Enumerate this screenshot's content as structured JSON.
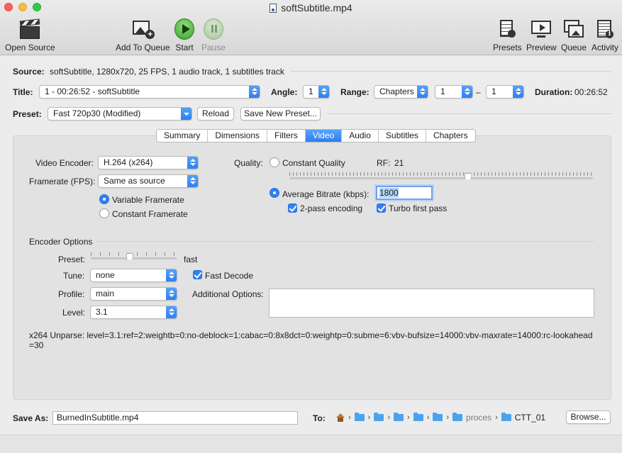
{
  "window": {
    "title": "softSubtitle.mp4"
  },
  "toolbar": {
    "open_source": "Open Source",
    "add_to_queue": "Add To Queue",
    "start": "Start",
    "pause": "Pause",
    "presets": "Presets",
    "preview": "Preview",
    "queue": "Queue",
    "activity": "Activity"
  },
  "source": {
    "label": "Source:",
    "value": "softSubtitle, 1280x720, 25 FPS, 1 audio track, 1 subtitles track"
  },
  "title_row": {
    "title_label": "Title:",
    "title_value": "1 - 00:26:52 - softSubtitle",
    "angle_label": "Angle:",
    "angle_value": "1",
    "range_label": "Range:",
    "range_value": "Chapters",
    "range_from": "1",
    "range_dash": "–",
    "range_to": "1",
    "duration_label": "Duration:",
    "duration_value": "00:26:52"
  },
  "preset_row": {
    "label": "Preset:",
    "value": "Fast 720p30 (Modified)",
    "reload": "Reload",
    "save_new": "Save New Preset..."
  },
  "tabs": [
    "Summary",
    "Dimensions",
    "Filters",
    "Video",
    "Audio",
    "Subtitles",
    "Chapters"
  ],
  "active_tab": "Video",
  "video": {
    "encoder_label": "Video Encoder:",
    "encoder_value": "H.264 (x264)",
    "framerate_label": "Framerate (FPS):",
    "framerate_value": "Same as source",
    "variable_framerate": "Variable Framerate",
    "constant_framerate": "Constant Framerate",
    "quality_label": "Quality:",
    "constant_quality": "Constant Quality",
    "rf_label": "RF:",
    "rf_value": "21",
    "rf_slider_fraction": 0.59,
    "average_bitrate": "Average Bitrate (kbps):",
    "bitrate_value": "1800",
    "two_pass": "2-pass encoding",
    "turbo": "Turbo first pass"
  },
  "encoder_options": {
    "title": "Encoder Options",
    "preset_label": "Preset:",
    "preset_value": "fast",
    "preset_slider_fraction": 0.45,
    "tune_label": "Tune:",
    "tune_value": "none",
    "fast_decode": "Fast Decode",
    "profile_label": "Profile:",
    "profile_value": "main",
    "additional_label": "Additional Options:",
    "level_label": "Level:",
    "level_value": "3.1",
    "unparse_line1": "x264 Unparse: level=3.1:ref=2:weightb=0:no-deblock=1:cabac=0:8x8dct=0:weightp=0:subme=6:vbv-bufsize=14000:vbv-maxrate=14000:rc-lookahead",
    "unparse_line2": "=30"
  },
  "save": {
    "label": "Save As:",
    "filename": "BurnedInSubtitle.mp4",
    "to_label": "To:",
    "path_partial": "proces",
    "path_last": "CTT_01",
    "browse": "Browse..."
  },
  "icons": [
    "clapperboard-icon",
    "add-to-queue-icon",
    "start-icon",
    "pause-icon",
    "presets-icon",
    "preview-icon",
    "queue-icon",
    "activity-icon",
    "home-folder-icon",
    "folder-icon"
  ],
  "colors": {
    "accent": "#2f80f2",
    "start_green": "#3e9e2c"
  }
}
